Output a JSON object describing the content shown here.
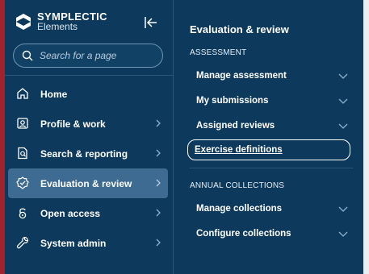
{
  "brand": {
    "line1": "SYMPLECTIC",
    "line2": "Elements"
  },
  "search": {
    "placeholder": "Search for a page"
  },
  "nav": {
    "items": [
      {
        "label": "Home",
        "icon": "home-icon"
      },
      {
        "label": "Profile & work",
        "icon": "profile-icon"
      },
      {
        "label": "Search & reporting",
        "icon": "report-icon"
      },
      {
        "label": "Evaluation & review",
        "icon": "badge-check-icon",
        "active": true
      },
      {
        "label": "Open access",
        "icon": "lock-icon"
      },
      {
        "label": "System admin",
        "icon": "wrench-icon"
      }
    ]
  },
  "panel": {
    "title": "Evaluation & review",
    "sections": [
      {
        "label": "ASSESSMENT",
        "items": [
          {
            "label": "Manage assessment"
          },
          {
            "label": "My submissions"
          },
          {
            "label": "Assigned reviews"
          },
          {
            "label": "Exercise definitions",
            "focused": true
          }
        ]
      },
      {
        "label": "ANNUAL COLLECTIONS",
        "items": [
          {
            "label": "Manage collections"
          },
          {
            "label": "Configure collections"
          }
        ]
      }
    ]
  },
  "colors": {
    "background": "#0d3a5c",
    "active_item": "#3d6b92",
    "accent_bar": "#a0222b"
  }
}
